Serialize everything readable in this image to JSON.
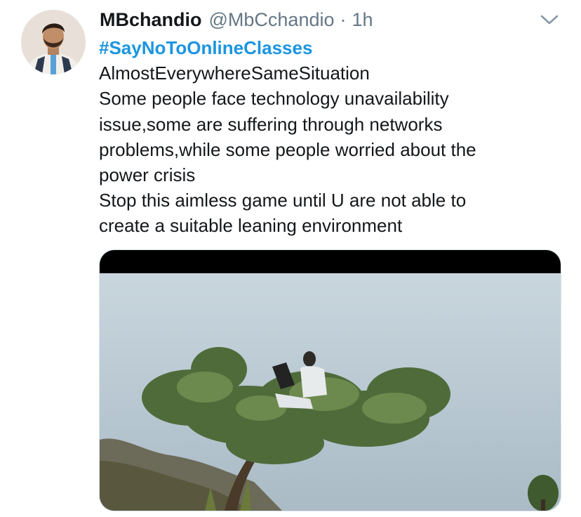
{
  "tweet": {
    "display_name": "MBchandio",
    "handle": "@MbCchandio",
    "separator": "·",
    "timestamp": "1h",
    "hashtag": "#SayNoToOnlineClasses",
    "lines": [
      "AlmostEverywhereSameSituation",
      "Some people face technology unavailability",
      "issue,some are suffering through networks",
      "problems,while some people worried about the",
      "power crisis",
      "Stop this aimless game until U are not able to",
      "create a suitable leaning environment"
    ]
  },
  "icons": {
    "menu": "chevron-down-icon"
  },
  "colors": {
    "link": "#1b95e0",
    "secondary_text": "#657786",
    "primary_text": "#14171a"
  }
}
